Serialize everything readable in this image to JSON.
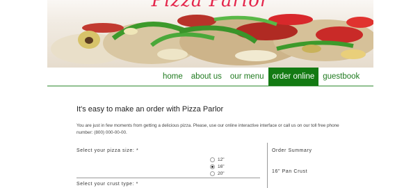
{
  "brand": {
    "title": "Pizza Parlor"
  },
  "nav": {
    "items": [
      {
        "label": "home",
        "active": false
      },
      {
        "label": "about us",
        "active": false
      },
      {
        "label": "our menu",
        "active": false
      },
      {
        "label": "order online",
        "active": true
      },
      {
        "label": "guestbook",
        "active": false
      }
    ]
  },
  "main": {
    "title": "It's easy to make an order with Pizza Parlor",
    "intro": "You are just in few moments from getting a delicious pizza. Please, use our online interactive interface or call us on our toll free phone number: (800) 000-00-00."
  },
  "form": {
    "size_label": "Select your pizza size: *",
    "size_options": [
      {
        "label": "12\"",
        "checked": false
      },
      {
        "label": "16\"",
        "checked": true
      },
      {
        "label": "20\"",
        "checked": false
      }
    ],
    "crust_label": "Select your crust type: *"
  },
  "summary": {
    "title": "Order Summary",
    "item": "16\" Pan Crust"
  },
  "colors": {
    "nav_green": "#137a13",
    "brand_red": "#e4254b"
  }
}
